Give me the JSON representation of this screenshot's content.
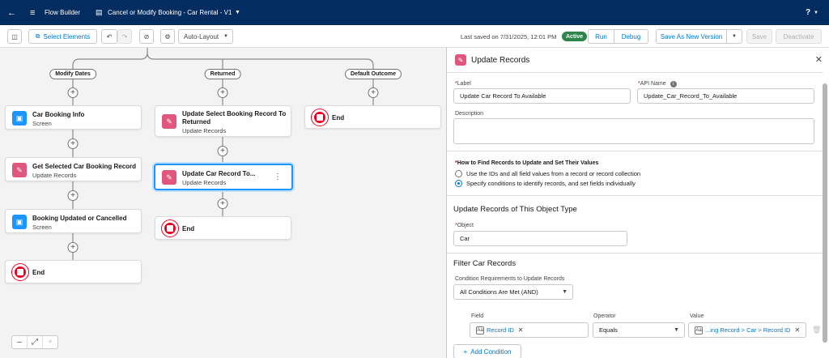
{
  "topbar": {
    "app_name": "Flow Builder",
    "flow_name": "Cancel or Modify Booking - Car Rental - V1",
    "help": "?"
  },
  "toolbar": {
    "select_elements": "Select Elements",
    "layout": "Auto-Layout",
    "last_saved": "Last saved on 7/31/2025, 12:01 PM",
    "status": "Active",
    "run": "Run",
    "debug": "Debug",
    "save_as_new": "Save As New Version",
    "save": "Save",
    "deactivate": "Deactivate"
  },
  "canvas": {
    "branches": [
      "Modify Dates",
      "Returned",
      "Default Outcome"
    ],
    "col1": [
      {
        "title": "Car Booking Info",
        "sub": "Screen",
        "icon": "screen-icon"
      },
      {
        "title": "Get Selected Car Booking Record",
        "sub": "Update Records",
        "icon": "update-records-icon"
      },
      {
        "title": "Booking Updated or Cancelled",
        "sub": "Screen",
        "icon": "screen-icon"
      },
      {
        "title": "End"
      }
    ],
    "col2": [
      {
        "title": "Update Select Booking Record To Returned",
        "sub": "Update Records",
        "icon": "update-records-icon"
      },
      {
        "title": "Update Car Record To...",
        "sub": "Update Records",
        "icon": "update-records-icon"
      },
      {
        "title": "End"
      }
    ],
    "col3": [
      {
        "title": "End"
      }
    ]
  },
  "panel": {
    "title": "Update Records",
    "label_label": "Label",
    "label_value": "Update Car Record To Available",
    "api_label": "API Name",
    "api_value": "Update_Car_Record_To_Available",
    "description_label": "Description",
    "find_label": "How to Find Records to Update and Set Their Values",
    "option1": "Use the IDs and all field values from a record or record collection",
    "option2": "Specify conditions to identify records, and set fields individually",
    "object_section": "Update Records of This Object Type",
    "object_label": "Object",
    "object_value": "Car",
    "filter_section": "Filter Car Records",
    "condition_req_label": "Condition Requirements to Update Records",
    "condition_req_value": "All Conditions Are Met (AND)",
    "field_label": "Field",
    "field_value": "Record ID",
    "operator_label": "Operator",
    "operator_value": "Equals",
    "value_label": "Value",
    "value_value": "...ing Record > Car > Record ID",
    "add_condition": "Add Condition"
  }
}
